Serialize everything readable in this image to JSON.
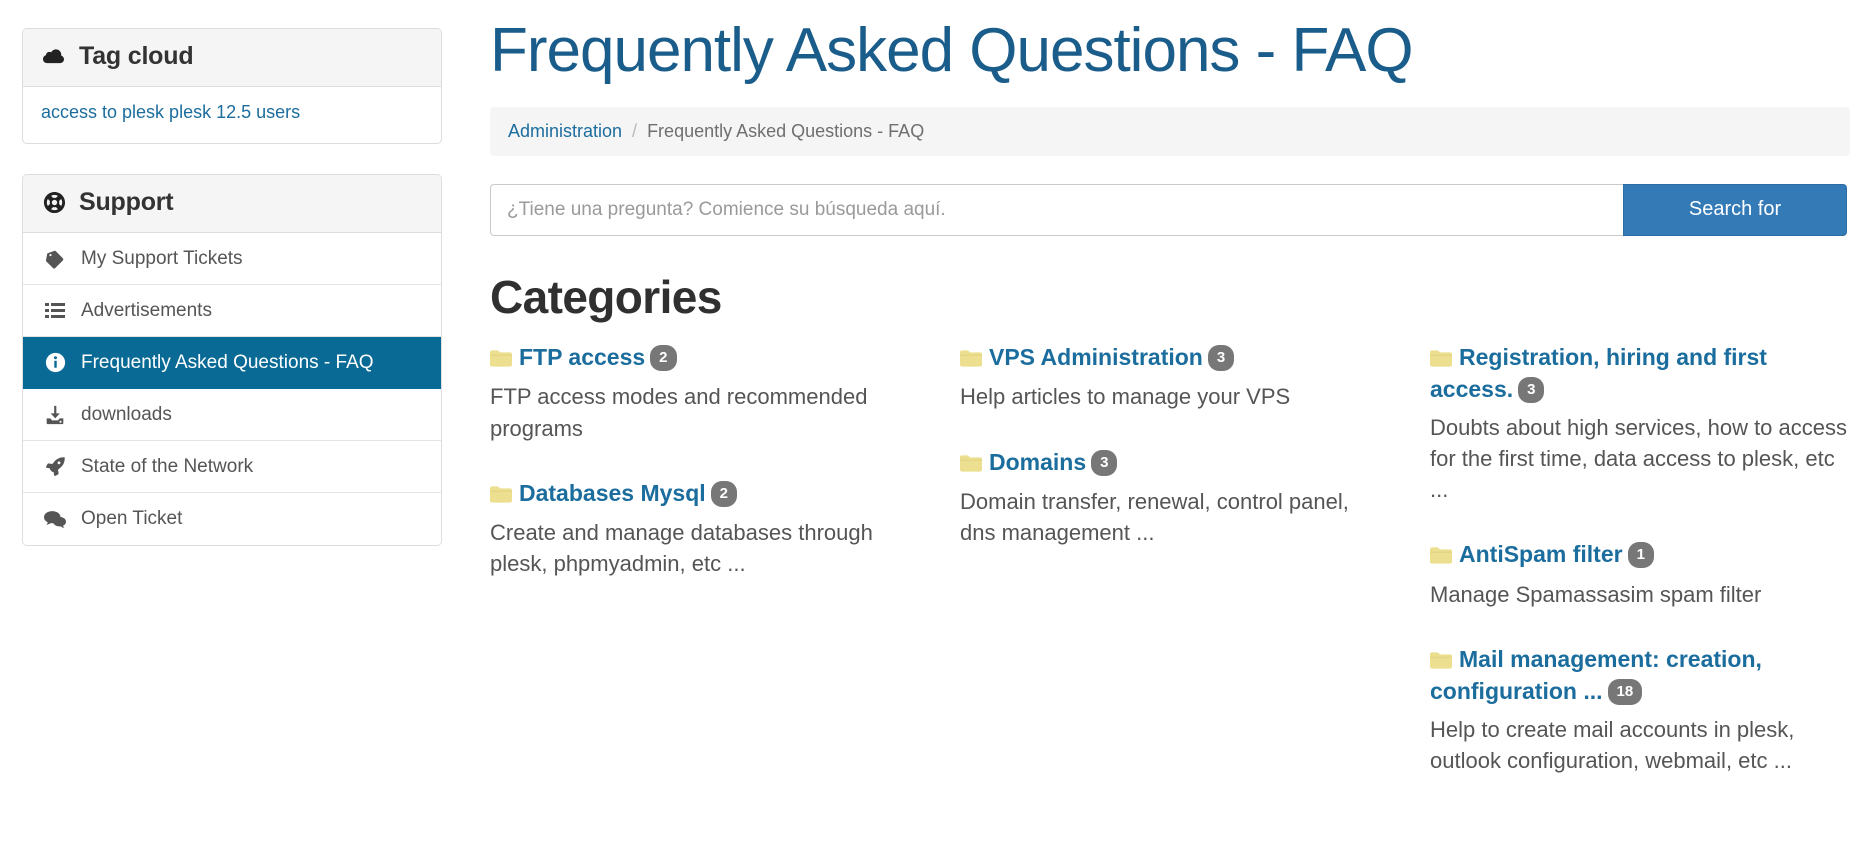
{
  "sidebar": {
    "tag_cloud": {
      "icon": "cloud-icon",
      "title": "Tag cloud",
      "tags": [
        "access to plesk plesk 12.5 users"
      ]
    },
    "support": {
      "icon": "lifebuoy-icon",
      "title": "Support",
      "items": [
        {
          "label": "My Support Tickets",
          "icon": "ticket-icon",
          "active": false
        },
        {
          "label": "Advertisements",
          "icon": "list-icon",
          "active": false
        },
        {
          "label": "Frequently Asked Questions - FAQ",
          "icon": "info-circle-icon",
          "active": true
        },
        {
          "label": "downloads",
          "icon": "download-icon",
          "active": false
        },
        {
          "label": "State of the Network",
          "icon": "rocket-icon",
          "active": false
        },
        {
          "label": "Open Ticket",
          "icon": "comments-icon",
          "active": false
        }
      ]
    }
  },
  "main": {
    "page_title": "Frequently Asked Questions - FAQ",
    "breadcrumb": {
      "root": "Administration",
      "separator": "/",
      "current": "Frequently Asked Questions - FAQ"
    },
    "search": {
      "placeholder": "¿Tiene una pregunta? Comience su búsqueda aquí.",
      "value": "",
      "button_label": "Search for"
    },
    "categories_heading": "Categories",
    "columns": [
      {
        "items": [
          {
            "title": "FTP access",
            "count": "2",
            "description": "FTP access modes and recommended programs"
          },
          {
            "title": "Databases Mysql",
            "count": "2",
            "description": "Create and manage databases through plesk, phpmyadmin, etc ..."
          }
        ]
      },
      {
        "items": [
          {
            "title": "VPS Administration",
            "count": "3",
            "description": "Help articles to manage your VPS"
          },
          {
            "title": "Domains",
            "count": "3",
            "description": "Domain transfer, renewal, control panel, dns management ..."
          }
        ]
      },
      {
        "items": [
          {
            "title": "Registration, hiring and first access.",
            "count": "3",
            "description": "Doubts about high services, how to access for the first time, data access to plesk, etc ..."
          },
          {
            "title": "AntiSpam filter",
            "count": "1",
            "description": "Manage Spamassasim spam filter"
          },
          {
            "title": "Mail management: creation, configuration ...",
            "count": "18",
            "description": "Help to create mail accounts in plesk, outlook configuration, webmail, etc ..."
          }
        ]
      }
    ]
  },
  "colors": {
    "accent_blue": "#1b6d9e",
    "active_blue": "#0a6a96",
    "button_blue": "#337ab7",
    "folder_yellow": "#ecdf8f",
    "badge_gray": "#777777",
    "title_blue": "#1a5c8a"
  }
}
